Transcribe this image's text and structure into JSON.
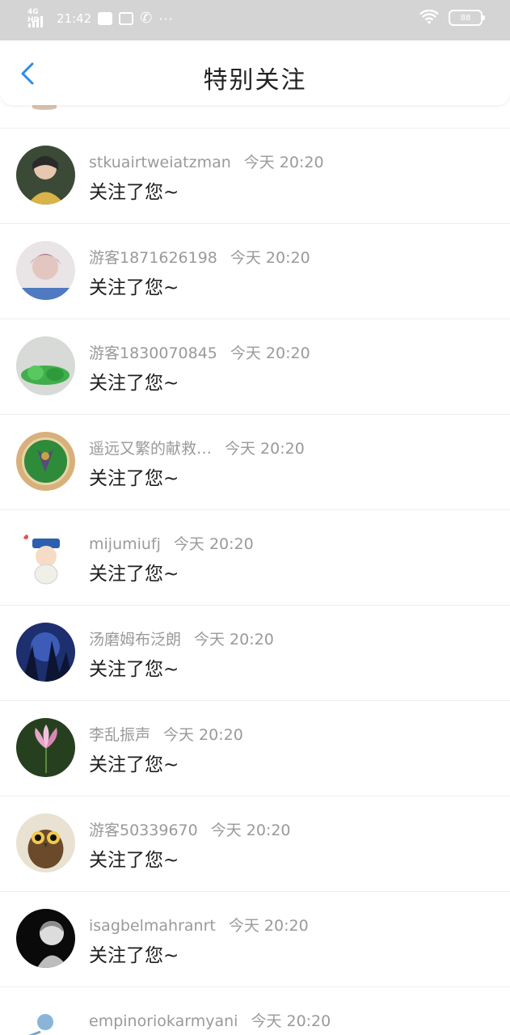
{
  "status_bar": {
    "network": "4G HD",
    "time": "21:42",
    "battery": "88",
    "more": "···"
  },
  "header": {
    "title": "特别关注"
  },
  "feed": {
    "items": [
      {
        "username": "stkuairtweiatzman",
        "time": "今天 20:20",
        "message": "关注了您~"
      },
      {
        "username": "游客1871626198",
        "time": "今天 20:20",
        "message": "关注了您~"
      },
      {
        "username": "游客1830070845",
        "time": "今天 20:20",
        "message": "关注了您~"
      },
      {
        "username": "遥远又繁的献救…",
        "time": "今天 20:20",
        "message": "关注了您~"
      },
      {
        "username": "mijumiufj",
        "time": "今天 20:20",
        "message": "关注了您~"
      },
      {
        "username": "汤磨姆布泛朗",
        "time": "今天 20:20",
        "message": "关注了您~"
      },
      {
        "username": "李乱振声",
        "time": "今天 20:20",
        "message": "关注了您~"
      },
      {
        "username": "游客50339670",
        "time": "今天 20:20",
        "message": "关注了您~"
      },
      {
        "username": "isagbelmahranrt",
        "time": "今天 20:20",
        "message": "关注了您~"
      },
      {
        "username": "empinoriokarmyani",
        "time": "今天 20:20",
        "message": ""
      }
    ]
  }
}
